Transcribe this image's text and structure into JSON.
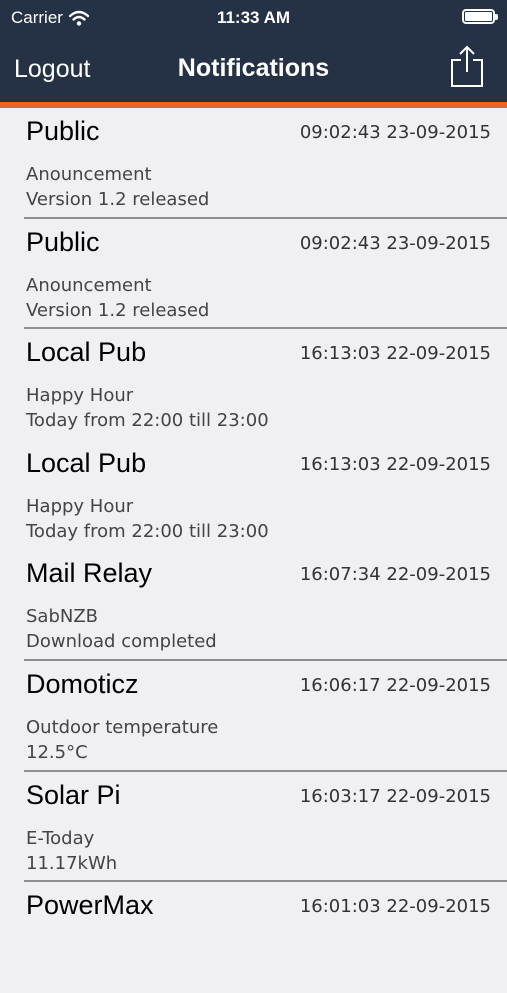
{
  "status_bar": {
    "carrier": "Carrier",
    "time": "11:33 AM"
  },
  "nav": {
    "logout": "Logout",
    "title": "Notifications"
  },
  "notifications": [
    {
      "title": "Public",
      "time": "09:02:43 23-09-2015",
      "subtitle": "Anouncement",
      "body": "Version 1.2 released"
    },
    {
      "title": "Public",
      "time": "09:02:43 23-09-2015",
      "subtitle": "Anouncement",
      "body": "Version 1.2 released"
    },
    {
      "title": "Local Pub",
      "time": "16:13:03 22-09-2015",
      "subtitle": "Happy Hour",
      "body": "Today from 22:00 till 23:00"
    },
    {
      "title": "Local Pub",
      "time": "16:13:03 22-09-2015",
      "subtitle": "Happy Hour",
      "body": "Today from 22:00 till 23:00"
    },
    {
      "title": "Mail Relay",
      "time": "16:07:34 22-09-2015",
      "subtitle": "SabNZB",
      "body": "Download completed"
    },
    {
      "title": "Domoticz",
      "time": "16:06:17 22-09-2015",
      "subtitle": "Outdoor temperature",
      "body": "12.5°C"
    },
    {
      "title": "Solar Pi",
      "time": "16:03:17 22-09-2015",
      "subtitle": "E-Today",
      "body": "11.17kWh"
    },
    {
      "title": "PowerMax",
      "time": "16:01:03 22-09-2015",
      "subtitle": "",
      "body": ""
    }
  ],
  "colors": {
    "navbar": "#253144",
    "accent": "#e8662a",
    "background": "#efeff4"
  }
}
